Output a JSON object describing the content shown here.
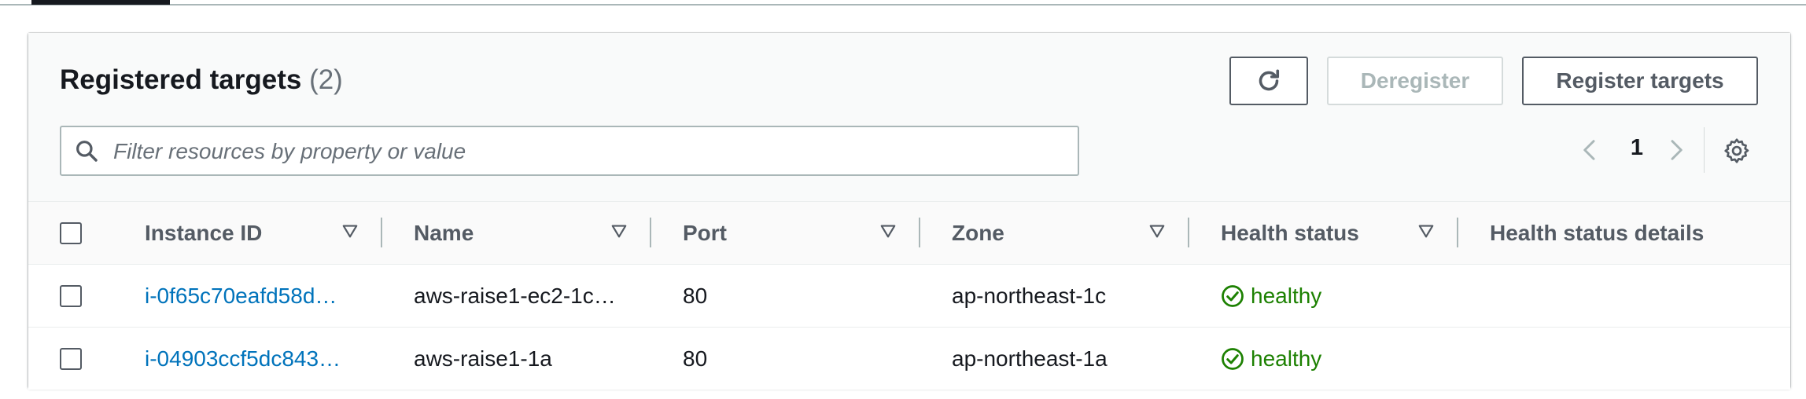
{
  "panel": {
    "title": "Registered targets",
    "count": "(2)"
  },
  "toolbar": {
    "refresh_icon": "refresh-icon",
    "deregister_label": "Deregister",
    "register_label": "Register targets"
  },
  "search": {
    "placeholder": "Filter resources by property or value",
    "value": ""
  },
  "pagination": {
    "current_page": "1"
  },
  "table": {
    "columns": [
      {
        "label": "Instance ID"
      },
      {
        "label": "Name"
      },
      {
        "label": "Port"
      },
      {
        "label": "Zone"
      },
      {
        "label": "Health status"
      },
      {
        "label": "Health status details"
      }
    ],
    "rows": [
      {
        "instance_id": "i-0f65c70eafd58d…",
        "name": "aws-raise1-ec2-1c…",
        "port": "80",
        "zone": "ap-northeast-1c",
        "health": "healthy",
        "details": ""
      },
      {
        "instance_id": "i-04903ccf5dc843…",
        "name": "aws-raise1-1a",
        "port": "80",
        "zone": "ap-northeast-1a",
        "health": "healthy",
        "details": ""
      }
    ]
  },
  "colors": {
    "link": "#0073bb",
    "healthy": "#1d8102",
    "border": "#545b64",
    "disabled": "#aab7b8"
  }
}
